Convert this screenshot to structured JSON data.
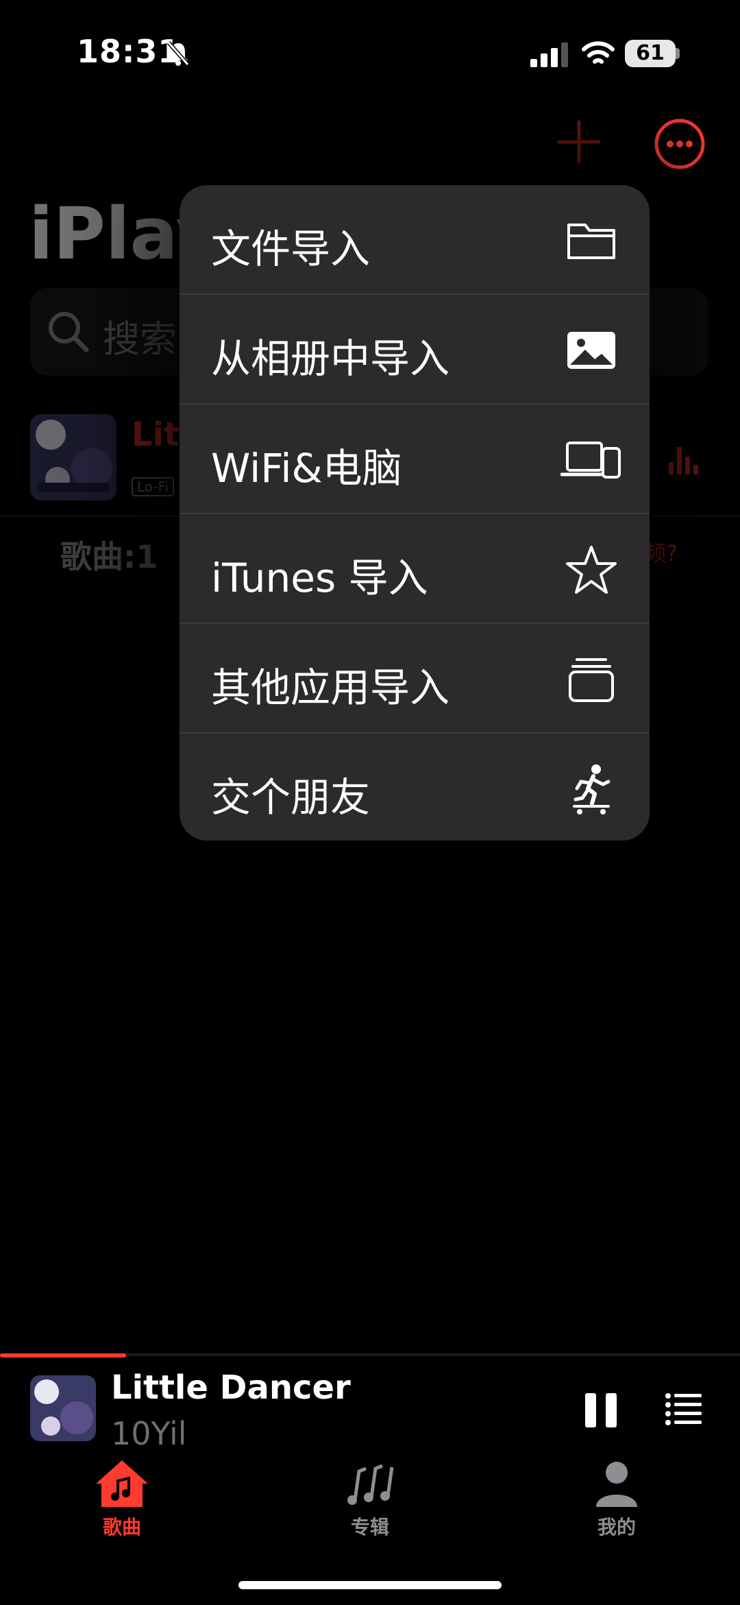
{
  "status_bar": {
    "time": "18:31",
    "battery": "61"
  },
  "page": {
    "title": "iPlay",
    "search_placeholder": "搜索"
  },
  "song_list": {
    "first_song_title": "Little Dancer",
    "first_song_tag": "Lo-Fi",
    "count_label": "歌曲:1",
    "help_link": "频?"
  },
  "menu": {
    "items": [
      {
        "label": "文件导入",
        "icon": "folder-icon"
      },
      {
        "label": "从相册中导入",
        "icon": "photo-icon"
      },
      {
        "label": "WiFi&电脑",
        "icon": "laptop-phone-icon"
      },
      {
        "label": "iTunes 导入",
        "icon": "star-icon"
      },
      {
        "label": "其他应用导入",
        "icon": "stack-icon"
      },
      {
        "label": "交个朋友",
        "icon": "skateboarder-icon"
      }
    ]
  },
  "mini_player": {
    "title": "Little Dancer",
    "artist": "10Yil",
    "progress": 0.17
  },
  "tab_bar": {
    "tabs": [
      {
        "label": "歌曲",
        "active": true
      },
      {
        "label": "专辑",
        "active": false
      },
      {
        "label": "我的",
        "active": false
      }
    ]
  },
  "colors": {
    "accent": "#ff3b30",
    "menu_bg": "#2b2b2d",
    "inactive": "#8e8e93"
  }
}
